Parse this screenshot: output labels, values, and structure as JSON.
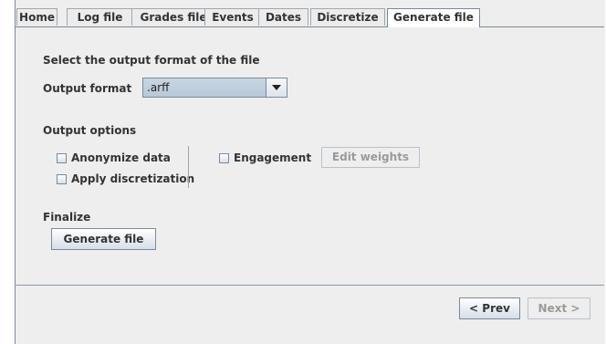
{
  "tabs": [
    "Home",
    "Log file",
    "Grades file",
    "Events",
    "Dates",
    "Discretize",
    "Generate file"
  ],
  "active_tab": "Generate file",
  "format_section": {
    "heading": "Select the output format of the file",
    "label": "Output format",
    "selected_value": ".arff"
  },
  "options_section": {
    "heading": "Output options",
    "anonymize_label": "Anonymize data",
    "discretization_label": "Apply discretization",
    "engagement_label": "Engagement",
    "edit_weights_label": "Edit weights"
  },
  "finalize_section": {
    "heading": "Finalize",
    "generate_label": "Generate file"
  },
  "nav": {
    "prev_label": "< Prev",
    "next_label": "Next >"
  }
}
